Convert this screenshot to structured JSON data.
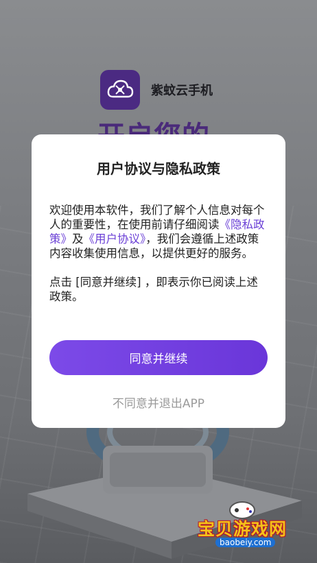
{
  "app": {
    "brand_name": "紫蚊云手机",
    "splash_headline": "开启您的"
  },
  "dialog": {
    "title": "用户协议与隐私政策",
    "body_intro": "欢迎使用本软件，我们了解个人信息对每个人的重要性，在使用前请仔细阅读",
    "privacy_link": "《隐私政策》",
    "conjunction": "及",
    "agreement_link": "《用户协议》",
    "body_rest": "，我们会遵循上述政策内容收集使用信息，以提供更好的服务。",
    "body_note": "点击 [同意并继续] ，即表示你已阅读上述政策。",
    "agree_button": "同意并继续",
    "decline_button": "不同意并退出APP"
  },
  "watermark": {
    "title": "宝贝游戏网",
    "url": "baobeiy.com"
  },
  "colors": {
    "accent": "#6a3fd6",
    "button_gradient_start": "#7c4ae8",
    "button_gradient_end": "#6a36d9",
    "overlay": "#7f8184"
  }
}
